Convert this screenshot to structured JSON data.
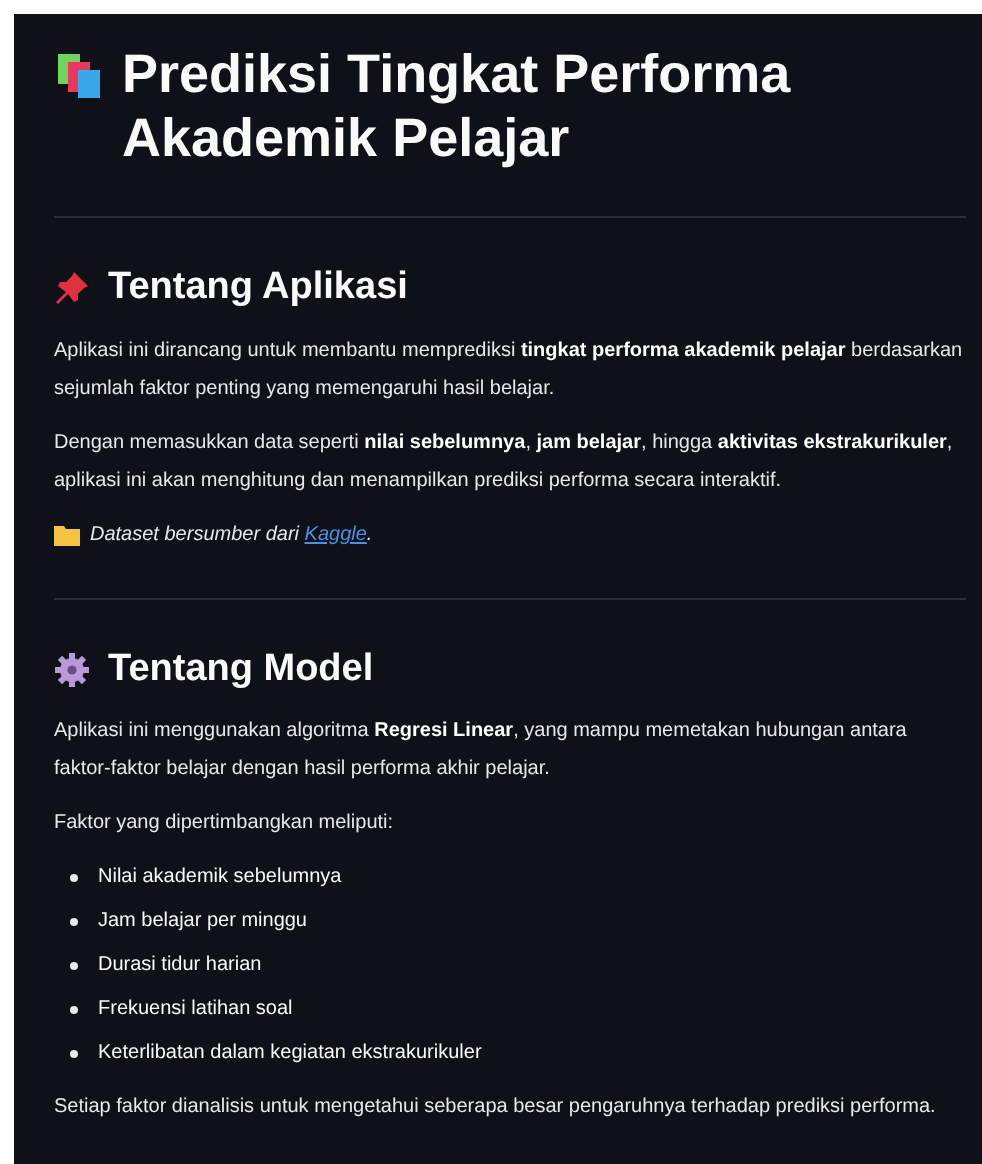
{
  "title": "Prediksi Tingkat Performa Akademik Pelajar",
  "sections": [
    {
      "heading": "Tentang Aplikasi",
      "blocks": [
        {
          "kind": "paragraph",
          "text": "Aplikasi ini dirancang untuk membantu memprediksi **tingkat performa akademik pelajar** berdasarkan sejumlah faktor penting yang memengaruhi hasil belajar."
        },
        {
          "kind": "paragraph",
          "text": "Dengan memasukkan data seperti **nilai sebelumnya**, **jam belajar**, hingga **aktivitas ekstrakurikuler**, aplikasi ini akan menghitung dan menampilkan prediksi performa secara interaktif."
        },
        {
          "kind": "source",
          "before": "Dataset bersumber dari ",
          "link": "Kaggle",
          "after": "."
        }
      ]
    },
    {
      "heading": "Tentang Model",
      "blocks": [
        {
          "kind": "paragraph",
          "text": "Aplikasi ini menggunakan algoritma **Regresi Linear**, yang mampu memetakan hubungan antara faktor-faktor belajar dengan hasil performa akhir pelajar."
        },
        {
          "kind": "paragraph",
          "text": "Faktor yang dipertimbangkan meliputi:"
        },
        {
          "kind": "list",
          "items": [
            "Nilai akademik sebelumnya",
            "Jam belajar per minggu",
            "Durasi tidur harian",
            "Frekuensi latihan soal",
            "Keterlibatan dalam kegiatan ekstrakurikuler"
          ]
        },
        {
          "kind": "paragraph",
          "text": "Setiap faktor dianalisis untuk mengetahui seberapa besar pengaruhnya terhadap prediksi performa."
        }
      ]
    }
  ]
}
